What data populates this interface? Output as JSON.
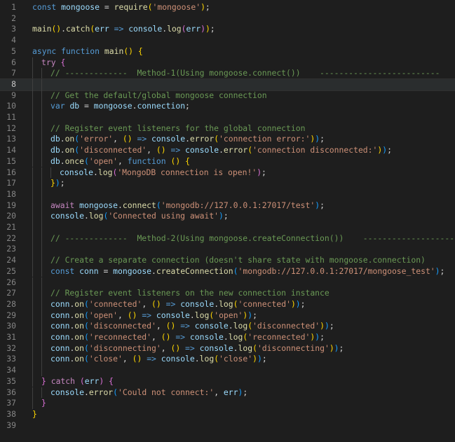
{
  "editor": {
    "language": "javascript",
    "active_line": 8,
    "lines": [
      {
        "n": "1",
        "indent": 0,
        "tokens": [
          [
            "kw",
            "const"
          ],
          [
            "pl",
            " "
          ],
          [
            "var",
            "mongoose"
          ],
          [
            "pl",
            " = "
          ],
          [
            "fn",
            "require"
          ],
          [
            "b1",
            "("
          ],
          [
            "str",
            "'mongoose'"
          ],
          [
            "b1",
            ")"
          ],
          [
            "pl",
            ";"
          ]
        ]
      },
      {
        "n": "2",
        "indent": 0,
        "tokens": []
      },
      {
        "n": "3",
        "indent": 0,
        "tokens": [
          [
            "fn",
            "main"
          ],
          [
            "b1",
            "()"
          ],
          [
            "pl",
            "."
          ],
          [
            "fn",
            "catch"
          ],
          [
            "b1",
            "("
          ],
          [
            "var",
            "err"
          ],
          [
            "pl",
            " "
          ],
          [
            "kw",
            "=>"
          ],
          [
            "pl",
            " "
          ],
          [
            "var",
            "console"
          ],
          [
            "pl",
            "."
          ],
          [
            "fn",
            "log"
          ],
          [
            "b2",
            "("
          ],
          [
            "var",
            "err"
          ],
          [
            "b2",
            ")"
          ],
          [
            "b1",
            ")"
          ],
          [
            "pl",
            ";"
          ]
        ]
      },
      {
        "n": "4",
        "indent": 0,
        "tokens": []
      },
      {
        "n": "5",
        "indent": 0,
        "tokens": [
          [
            "kw",
            "async"
          ],
          [
            "pl",
            " "
          ],
          [
            "kw",
            "function"
          ],
          [
            "pl",
            " "
          ],
          [
            "fn",
            "main"
          ],
          [
            "b1",
            "()"
          ],
          [
            "pl",
            " "
          ],
          [
            "b1",
            "{"
          ]
        ]
      },
      {
        "n": "6",
        "indent": 1,
        "tokens": [
          [
            "kw2",
            "try"
          ],
          [
            "pl",
            " "
          ],
          [
            "b2",
            "{"
          ]
        ]
      },
      {
        "n": "7",
        "indent": 2,
        "tokens": [
          [
            "cm",
            "// -------------  Method-1(Using mongoose.connect())    -------------------------"
          ]
        ]
      },
      {
        "n": "8",
        "indent": 2,
        "tokens": []
      },
      {
        "n": "9",
        "indent": 2,
        "tokens": [
          [
            "cm",
            "// Get the default/global mongoose connection"
          ]
        ]
      },
      {
        "n": "10",
        "indent": 2,
        "tokens": [
          [
            "kw",
            "var"
          ],
          [
            "pl",
            " "
          ],
          [
            "var",
            "db"
          ],
          [
            "pl",
            " = "
          ],
          [
            "var",
            "mongoose"
          ],
          [
            "pl",
            "."
          ],
          [
            "var",
            "connection"
          ],
          [
            "pl",
            ";"
          ]
        ]
      },
      {
        "n": "11",
        "indent": 2,
        "tokens": []
      },
      {
        "n": "12",
        "indent": 2,
        "tokens": [
          [
            "cm",
            "// Register event listeners for the global connection"
          ]
        ]
      },
      {
        "n": "13",
        "indent": 2,
        "tokens": [
          [
            "var",
            "db"
          ],
          [
            "pl",
            "."
          ],
          [
            "fn",
            "on"
          ],
          [
            "b3",
            "("
          ],
          [
            "str",
            "'error'"
          ],
          [
            "pl",
            ", "
          ],
          [
            "b1",
            "()"
          ],
          [
            "pl",
            " "
          ],
          [
            "kw",
            "=>"
          ],
          [
            "pl",
            " "
          ],
          [
            "var",
            "console"
          ],
          [
            "pl",
            "."
          ],
          [
            "fn",
            "error"
          ],
          [
            "b1",
            "("
          ],
          [
            "str",
            "'connection error:'"
          ],
          [
            "b1",
            ")"
          ],
          [
            "b3",
            ")"
          ],
          [
            "pl",
            ";"
          ]
        ]
      },
      {
        "n": "14",
        "indent": 2,
        "tokens": [
          [
            "var",
            "db"
          ],
          [
            "pl",
            "."
          ],
          [
            "fn",
            "on"
          ],
          [
            "b3",
            "("
          ],
          [
            "str",
            "'disconnected'"
          ],
          [
            "pl",
            ", "
          ],
          [
            "b1",
            "()"
          ],
          [
            "pl",
            " "
          ],
          [
            "kw",
            "=>"
          ],
          [
            "pl",
            " "
          ],
          [
            "var",
            "console"
          ],
          [
            "pl",
            "."
          ],
          [
            "fn",
            "error"
          ],
          [
            "b1",
            "("
          ],
          [
            "str",
            "'connection disconnected:'"
          ],
          [
            "b1",
            ")"
          ],
          [
            "b3",
            ")"
          ],
          [
            "pl",
            ";"
          ]
        ]
      },
      {
        "n": "15",
        "indent": 2,
        "tokens": [
          [
            "var",
            "db"
          ],
          [
            "pl",
            "."
          ],
          [
            "fn",
            "once"
          ],
          [
            "b3",
            "("
          ],
          [
            "str",
            "'open'"
          ],
          [
            "pl",
            ", "
          ],
          [
            "kw",
            "function"
          ],
          [
            "pl",
            " "
          ],
          [
            "b1",
            "()"
          ],
          [
            "pl",
            " "
          ],
          [
            "b1",
            "{"
          ]
        ]
      },
      {
        "n": "16",
        "indent": 3,
        "tokens": [
          [
            "var",
            "console"
          ],
          [
            "pl",
            "."
          ],
          [
            "fn",
            "log"
          ],
          [
            "b2",
            "("
          ],
          [
            "str",
            "'MongoDB connection is open!'"
          ],
          [
            "b2",
            ")"
          ],
          [
            "pl",
            ";"
          ]
        ]
      },
      {
        "n": "17",
        "indent": 2,
        "tokens": [
          [
            "b1",
            "}"
          ],
          [
            "b3",
            ")"
          ],
          [
            "pl",
            ";"
          ]
        ]
      },
      {
        "n": "18",
        "indent": 2,
        "tokens": []
      },
      {
        "n": "19",
        "indent": 2,
        "tokens": [
          [
            "kw2",
            "await"
          ],
          [
            "pl",
            " "
          ],
          [
            "var",
            "mongoose"
          ],
          [
            "pl",
            "."
          ],
          [
            "fn",
            "connect"
          ],
          [
            "b3",
            "("
          ],
          [
            "str",
            "'mongodb://127.0.0.1:27017/test'"
          ],
          [
            "b3",
            ")"
          ],
          [
            "pl",
            ";"
          ]
        ]
      },
      {
        "n": "20",
        "indent": 2,
        "tokens": [
          [
            "var",
            "console"
          ],
          [
            "pl",
            "."
          ],
          [
            "fn",
            "log"
          ],
          [
            "b3",
            "("
          ],
          [
            "str",
            "'Connected using await'"
          ],
          [
            "b3",
            ")"
          ],
          [
            "pl",
            ";"
          ]
        ]
      },
      {
        "n": "21",
        "indent": 2,
        "tokens": []
      },
      {
        "n": "22",
        "indent": 2,
        "tokens": [
          [
            "cm",
            "// -------------  Method-2(Using mongoose.createConnection())    ------------------------"
          ]
        ]
      },
      {
        "n": "23",
        "indent": 2,
        "tokens": []
      },
      {
        "n": "24",
        "indent": 2,
        "tokens": [
          [
            "cm",
            "// Create a separate connection (doesn't share state with mongoose.connection)"
          ]
        ]
      },
      {
        "n": "25",
        "indent": 2,
        "tokens": [
          [
            "kw",
            "const"
          ],
          [
            "pl",
            " "
          ],
          [
            "var",
            "conn"
          ],
          [
            "pl",
            " = "
          ],
          [
            "var",
            "mongoose"
          ],
          [
            "pl",
            "."
          ],
          [
            "fn",
            "createConnection"
          ],
          [
            "b3",
            "("
          ],
          [
            "str",
            "'mongodb://127.0.0.1:27017/mongoose_test'"
          ],
          [
            "b3",
            ")"
          ],
          [
            "pl",
            ";"
          ]
        ]
      },
      {
        "n": "26",
        "indent": 2,
        "tokens": []
      },
      {
        "n": "27",
        "indent": 2,
        "tokens": [
          [
            "cm",
            "// Register event listeners on the new connection instance"
          ]
        ]
      },
      {
        "n": "28",
        "indent": 2,
        "tokens": [
          [
            "var",
            "conn"
          ],
          [
            "pl",
            "."
          ],
          [
            "fn",
            "on"
          ],
          [
            "b3",
            "("
          ],
          [
            "str",
            "'connected'"
          ],
          [
            "pl",
            ", "
          ],
          [
            "b1",
            "()"
          ],
          [
            "pl",
            " "
          ],
          [
            "kw",
            "=>"
          ],
          [
            "pl",
            " "
          ],
          [
            "var",
            "console"
          ],
          [
            "pl",
            "."
          ],
          [
            "fn",
            "log"
          ],
          [
            "b1",
            "("
          ],
          [
            "str",
            "'connected'"
          ],
          [
            "b1",
            ")"
          ],
          [
            "b3",
            ")"
          ],
          [
            "pl",
            ";"
          ]
        ]
      },
      {
        "n": "29",
        "indent": 2,
        "tokens": [
          [
            "var",
            "conn"
          ],
          [
            "pl",
            "."
          ],
          [
            "fn",
            "on"
          ],
          [
            "b3",
            "("
          ],
          [
            "str",
            "'open'"
          ],
          [
            "pl",
            ", "
          ],
          [
            "b1",
            "()"
          ],
          [
            "pl",
            " "
          ],
          [
            "kw",
            "=>"
          ],
          [
            "pl",
            " "
          ],
          [
            "var",
            "console"
          ],
          [
            "pl",
            "."
          ],
          [
            "fn",
            "log"
          ],
          [
            "b1",
            "("
          ],
          [
            "str",
            "'open'"
          ],
          [
            "b1",
            ")"
          ],
          [
            "b3",
            ")"
          ],
          [
            "pl",
            ";"
          ]
        ]
      },
      {
        "n": "30",
        "indent": 2,
        "tokens": [
          [
            "var",
            "conn"
          ],
          [
            "pl",
            "."
          ],
          [
            "fn",
            "on"
          ],
          [
            "b3",
            "("
          ],
          [
            "str",
            "'disconnected'"
          ],
          [
            "pl",
            ", "
          ],
          [
            "b1",
            "()"
          ],
          [
            "pl",
            " "
          ],
          [
            "kw",
            "=>"
          ],
          [
            "pl",
            " "
          ],
          [
            "var",
            "console"
          ],
          [
            "pl",
            "."
          ],
          [
            "fn",
            "log"
          ],
          [
            "b1",
            "("
          ],
          [
            "str",
            "'disconnected'"
          ],
          [
            "b1",
            ")"
          ],
          [
            "b3",
            ")"
          ],
          [
            "pl",
            ";"
          ]
        ]
      },
      {
        "n": "31",
        "indent": 2,
        "tokens": [
          [
            "var",
            "conn"
          ],
          [
            "pl",
            "."
          ],
          [
            "fn",
            "on"
          ],
          [
            "b3",
            "("
          ],
          [
            "str",
            "'reconnected'"
          ],
          [
            "pl",
            ", "
          ],
          [
            "b1",
            "()"
          ],
          [
            "pl",
            " "
          ],
          [
            "kw",
            "=>"
          ],
          [
            "pl",
            " "
          ],
          [
            "var",
            "console"
          ],
          [
            "pl",
            "."
          ],
          [
            "fn",
            "log"
          ],
          [
            "b1",
            "("
          ],
          [
            "str",
            "'reconnected'"
          ],
          [
            "b1",
            ")"
          ],
          [
            "b3",
            ")"
          ],
          [
            "pl",
            ";"
          ]
        ]
      },
      {
        "n": "32",
        "indent": 2,
        "tokens": [
          [
            "var",
            "conn"
          ],
          [
            "pl",
            "."
          ],
          [
            "fn",
            "on"
          ],
          [
            "b3",
            "("
          ],
          [
            "str",
            "'disconnecting'"
          ],
          [
            "pl",
            ", "
          ],
          [
            "b1",
            "()"
          ],
          [
            "pl",
            " "
          ],
          [
            "kw",
            "=>"
          ],
          [
            "pl",
            " "
          ],
          [
            "var",
            "console"
          ],
          [
            "pl",
            "."
          ],
          [
            "fn",
            "log"
          ],
          [
            "b1",
            "("
          ],
          [
            "str",
            "'disconnecting'"
          ],
          [
            "b1",
            ")"
          ],
          [
            "b3",
            ")"
          ],
          [
            "pl",
            ";"
          ]
        ]
      },
      {
        "n": "33",
        "indent": 2,
        "tokens": [
          [
            "var",
            "conn"
          ],
          [
            "pl",
            "."
          ],
          [
            "fn",
            "on"
          ],
          [
            "b3",
            "("
          ],
          [
            "str",
            "'close'"
          ],
          [
            "pl",
            ", "
          ],
          [
            "b1",
            "()"
          ],
          [
            "pl",
            " "
          ],
          [
            "kw",
            "=>"
          ],
          [
            "pl",
            " "
          ],
          [
            "var",
            "console"
          ],
          [
            "pl",
            "."
          ],
          [
            "fn",
            "log"
          ],
          [
            "b1",
            "("
          ],
          [
            "str",
            "'close'"
          ],
          [
            "b1",
            ")"
          ],
          [
            "b3",
            ")"
          ],
          [
            "pl",
            ";"
          ]
        ]
      },
      {
        "n": "34",
        "indent": 2,
        "tokens": []
      },
      {
        "n": "35",
        "indent": 1,
        "tokens": [
          [
            "b2",
            "}"
          ],
          [
            "pl",
            " "
          ],
          [
            "kw2",
            "catch"
          ],
          [
            "pl",
            " "
          ],
          [
            "b2",
            "("
          ],
          [
            "var",
            "err"
          ],
          [
            "b2",
            ")"
          ],
          [
            "pl",
            " "
          ],
          [
            "b2",
            "{"
          ]
        ]
      },
      {
        "n": "36",
        "indent": 2,
        "tokens": [
          [
            "var",
            "console"
          ],
          [
            "pl",
            "."
          ],
          [
            "fn",
            "error"
          ],
          [
            "b3",
            "("
          ],
          [
            "str",
            "'Could not connect:'"
          ],
          [
            "pl",
            ", "
          ],
          [
            "var",
            "err"
          ],
          [
            "b3",
            ")"
          ],
          [
            "pl",
            ";"
          ]
        ]
      },
      {
        "n": "37",
        "indent": 1,
        "tokens": [
          [
            "b2",
            "}"
          ]
        ]
      },
      {
        "n": "38",
        "indent": 0,
        "tokens": [
          [
            "b1",
            "}"
          ]
        ]
      },
      {
        "n": "39",
        "indent": 0,
        "tokens": []
      }
    ]
  }
}
